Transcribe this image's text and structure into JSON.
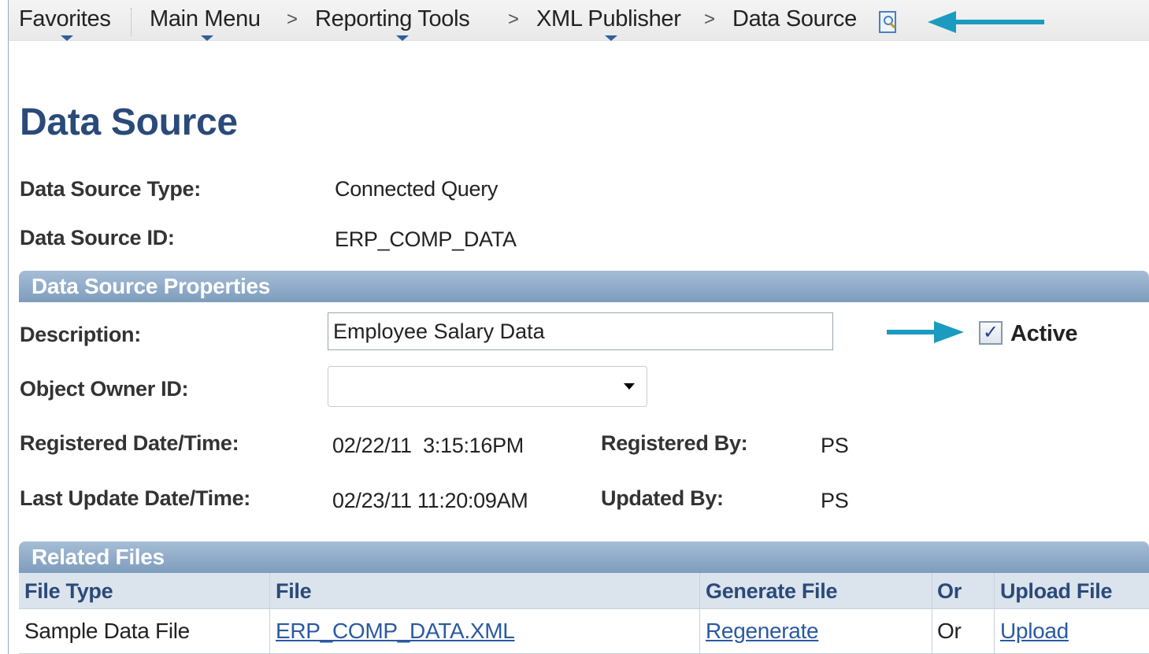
{
  "breadcrumb": {
    "favorites": "Favorites",
    "main_menu": "Main Menu",
    "reporting_tools": "Reporting Tools",
    "xml_publisher": "XML Publisher",
    "current": "Data Source",
    "separator": ">"
  },
  "page_title": "Data Source",
  "header_fields": {
    "type_label": "Data Source Type:",
    "type_value": "Connected Query",
    "id_label": "Data Source ID:",
    "id_value": "ERP_COMP_DATA"
  },
  "properties": {
    "section_title": "Data Source Properties",
    "description_label": "Description:",
    "description_value": "Employee Salary Data",
    "active_label": "Active",
    "active_checked": true,
    "owner_label": "Object Owner ID:",
    "owner_value": "",
    "registered_label": "Registered Date/Time:",
    "registered_value": "02/22/11  3:15:16PM",
    "registered_by_label": "Registered By:",
    "registered_by_value": "PS",
    "updated_label": "Last Update Date/Time:",
    "updated_value": "02/23/11 11:20:09AM",
    "updated_by_label": "Updated By:",
    "updated_by_value": "PS"
  },
  "related_files": {
    "section_title": "Related Files",
    "columns": [
      "File Type",
      "File",
      "Generate File",
      "Or",
      "Upload File"
    ],
    "rows": [
      {
        "file_type": "Sample Data File",
        "file": "ERP_COMP_DATA.XML",
        "generate": "Regenerate",
        "or": "Or",
        "upload": "Upload"
      }
    ]
  },
  "colors": {
    "title": "#2a4a7a",
    "section_bar": "#8ea9c7",
    "link": "#2a5aa0",
    "annotation_arrow": "#1a9bbf"
  }
}
